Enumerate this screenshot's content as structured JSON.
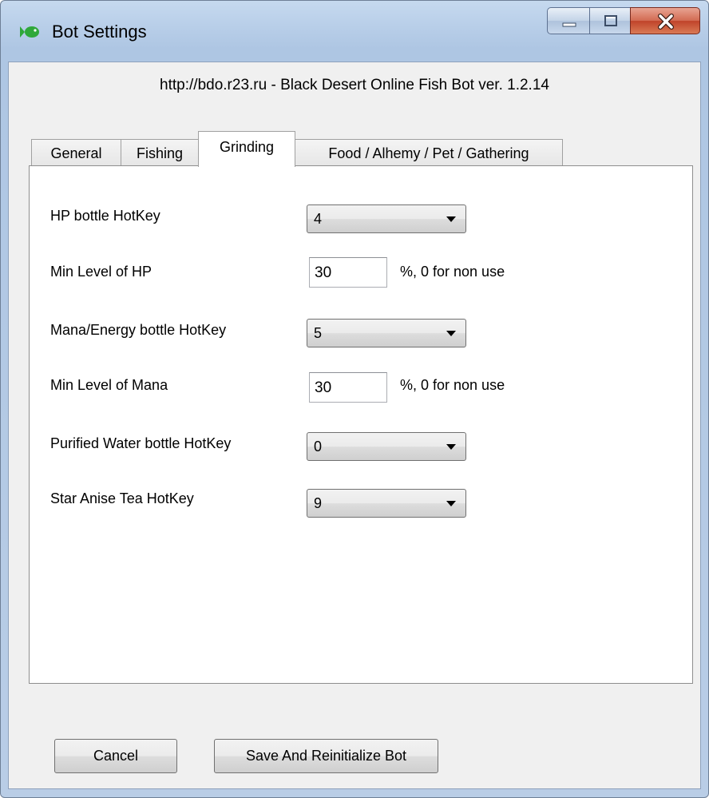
{
  "window": {
    "title": "Bot Settings",
    "icon": "fish-icon",
    "controls": [
      "minimize-icon",
      "maximize-icon",
      "close-icon"
    ]
  },
  "header": {
    "text": "http://bdo.r23.ru - Black Desert Online Fish Bot ver. 1.2.14"
  },
  "tabs": [
    {
      "label": "General",
      "active": false
    },
    {
      "label": "Fishing",
      "active": false
    },
    {
      "label": "Grinding",
      "active": true
    },
    {
      "label": "Food / Alhemy / Pet / Gathering",
      "active": false
    }
  ],
  "grinding": {
    "hp_hotkey": {
      "label": "HP bottle HotKey",
      "value": "4"
    },
    "min_hp": {
      "label": "Min Level of HP",
      "value": "30",
      "suffix": "%, 0 for non use"
    },
    "mana_hotkey": {
      "label": "Mana/Energy bottle HotKey",
      "value": "5"
    },
    "min_mana": {
      "label": "Min Level of Mana",
      "value": "30",
      "suffix": "%, 0 for non use"
    },
    "water_hotkey": {
      "label": "Purified Water bottle HotKey",
      "value": "0"
    },
    "tea_hotkey": {
      "label": "Star Anise Tea HotKey",
      "value": "9"
    }
  },
  "buttons": {
    "cancel": "Cancel",
    "save": "Save And Reinitialize Bot"
  },
  "colors": {
    "frame": "#b9cfe9",
    "close": "#c0432a"
  }
}
